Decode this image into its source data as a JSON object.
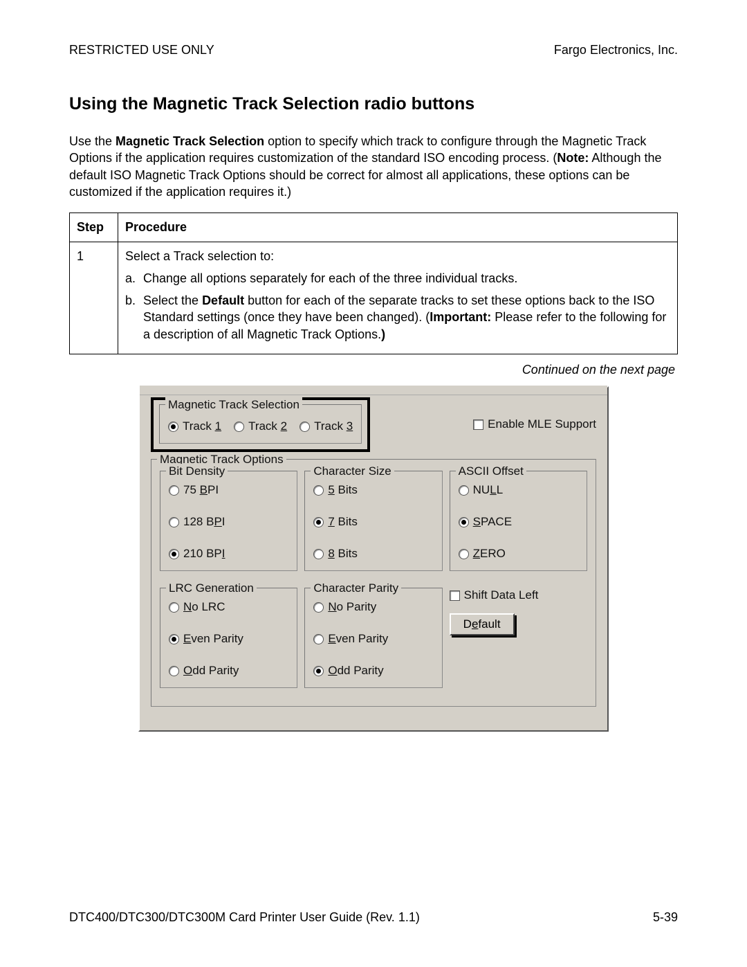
{
  "header": {
    "left": "RESTRICTED USE ONLY",
    "right": "Fargo Electronics, Inc."
  },
  "title": "Using the Magnetic Track Selection radio buttons",
  "intro": {
    "pre": "Use the ",
    "bold1": "Magnetic Track Selection",
    "mid": " option to specify which track to configure through the Magnetic Track Options if the application requires customization of the standard ISO encoding process. (",
    "bold2": "Note:",
    "post": "  Although the default ISO Magnetic Track Options should be correct for almost all applications, these options can be customized if the application requires it.)"
  },
  "table": {
    "head_step": "Step",
    "head_proc": "Procedure",
    "step_num": "1",
    "intro_line": "Select a Track selection to:",
    "a_mark": "a.",
    "a_text": "Change all options separately for each of the three individual tracks.",
    "b_mark": "b.",
    "b_pre": "Select the ",
    "b_bold1": "Default",
    "b_mid": " button for each of the separate tracks to set these options back to the ISO Standard settings (once they have been changed).",
    "b_open": " (",
    "b_bold2": "Important:",
    "b_post": "  Please refer to the following for a description of all Magnetic Track Options.",
    "b_close": ")"
  },
  "continued": "Continued on the next page",
  "dialog": {
    "track_sel_legend": "Magnetic Track Selection",
    "track1": "Track 1",
    "track2": "Track 2",
    "track3": "Track 3",
    "enable_mle": "Enable MLE Support",
    "track_selected": "track1",
    "opts_legend": "Magnetic Track Options",
    "bit_density": {
      "legend": "Bit Density",
      "opt1": " 75 BPI",
      "opt2": "128 BPI",
      "opt3": "210 BPI",
      "selected": "opt3"
    },
    "char_size": {
      "legend": "Character Size",
      "opt1": "5 Bits",
      "opt2": "7 Bits",
      "opt3": "8 Bits",
      "selected": "opt2"
    },
    "ascii_offset": {
      "legend": "ASCII Offset",
      "opt1": "NULL",
      "opt2": "SPACE",
      "opt3": "ZERO",
      "selected": "opt2"
    },
    "lrc": {
      "legend": "LRC Generation",
      "opt1": "No LRC",
      "opt2": "Even Parity",
      "opt3": "Odd Parity",
      "selected": "opt2"
    },
    "char_parity": {
      "legend": "Character Parity",
      "opt1": "No Parity",
      "opt2": "Even Parity",
      "opt3": "Odd Parity",
      "selected": "opt3"
    },
    "shift_left": "Shift Data Left",
    "default_btn": "Default"
  },
  "footer": {
    "left": "DTC400/DTC300/DTC300M Card Printer User Guide (Rev. 1.1)",
    "right": "5-39"
  }
}
